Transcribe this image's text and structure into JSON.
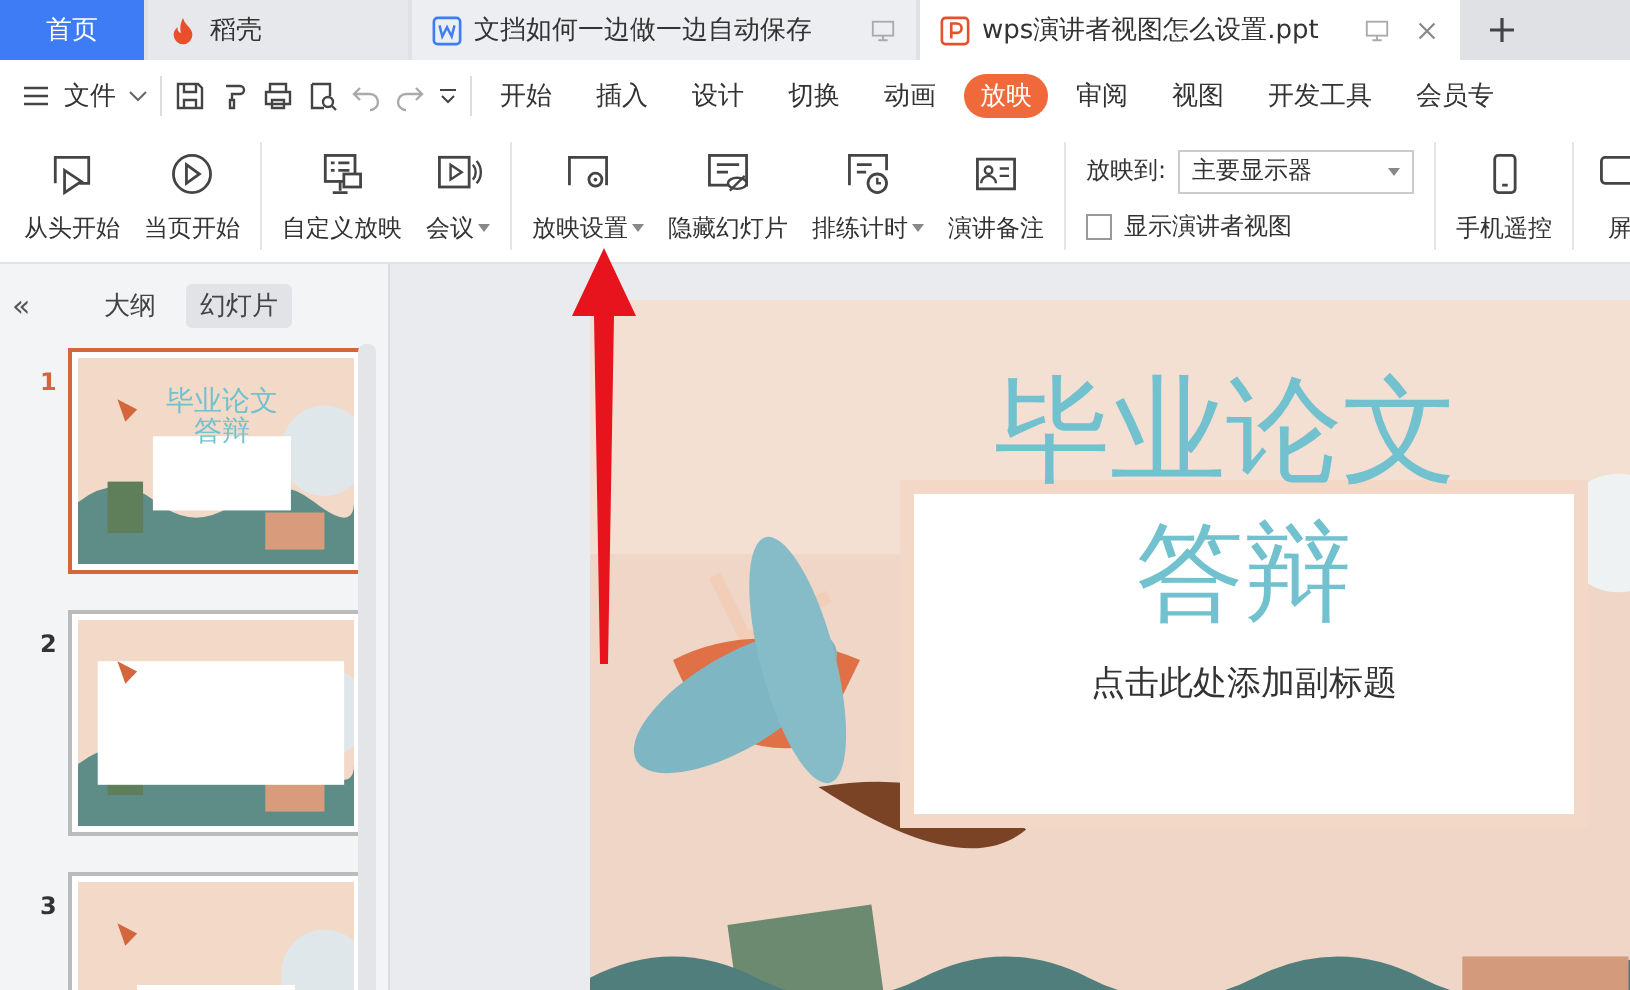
{
  "tabs": [
    {
      "label": "首页",
      "kind": "home",
      "selected": false
    },
    {
      "label": "稻壳",
      "kind": "docer",
      "selected": false
    },
    {
      "label": "文挡如何一边做一边自动保存",
      "kind": "word",
      "selected": false
    },
    {
      "label": "wps演讲者视图怎么设置.ppt",
      "kind": "ppt",
      "selected": true
    }
  ],
  "menu": {
    "file": "文件",
    "items": [
      {
        "label": "开始",
        "selected": false
      },
      {
        "label": "插入",
        "selected": false
      },
      {
        "label": "设计",
        "selected": false
      },
      {
        "label": "切换",
        "selected": false
      },
      {
        "label": "动画",
        "selected": false
      },
      {
        "label": "放映",
        "selected": true
      },
      {
        "label": "审阅",
        "selected": false
      },
      {
        "label": "视图",
        "selected": false
      },
      {
        "label": "开发工具",
        "selected": false
      },
      {
        "label": "会员专",
        "selected": false
      }
    ]
  },
  "ribbon": {
    "groups": [
      [
        {
          "label": "从头开始",
          "kind": "play-screen",
          "dropdown": false
        },
        {
          "label": "当页开始",
          "kind": "play-circle",
          "dropdown": false
        }
      ],
      [
        {
          "label": "自定义放映",
          "kind": "custom",
          "dropdown": false
        },
        {
          "label": "会议",
          "kind": "meeting",
          "dropdown": true
        }
      ],
      [
        {
          "label": "放映设置",
          "kind": "settings",
          "dropdown": true
        },
        {
          "label": "隐藏幻灯片",
          "kind": "hide",
          "dropdown": false
        },
        {
          "label": "排练计时",
          "kind": "timer",
          "dropdown": true
        },
        {
          "label": "演讲备注",
          "kind": "notes",
          "dropdown": false
        }
      ]
    ],
    "display_to_label": "放映到:",
    "display_to_value": "主要显示器",
    "presenter_view": {
      "label": "显示演讲者视图",
      "checked": false
    },
    "right": [
      {
        "label": "手机遥控",
        "kind": "phone"
      },
      {
        "label": "屏",
        "kind": "screen"
      }
    ]
  },
  "panel": {
    "collapse": "«",
    "tabs": [
      {
        "label": "大纲",
        "selected": false
      },
      {
        "label": "幻灯片",
        "selected": true
      }
    ],
    "slides": [
      {
        "number": "1",
        "selected": true,
        "title": "毕业论文答辩"
      },
      {
        "number": "2",
        "selected": false
      },
      {
        "number": "3",
        "selected": false
      }
    ]
  },
  "slide": {
    "title_line_1": "毕业论文",
    "title_line_2": "答辩",
    "subtitle": "点击此处添加副标题"
  }
}
